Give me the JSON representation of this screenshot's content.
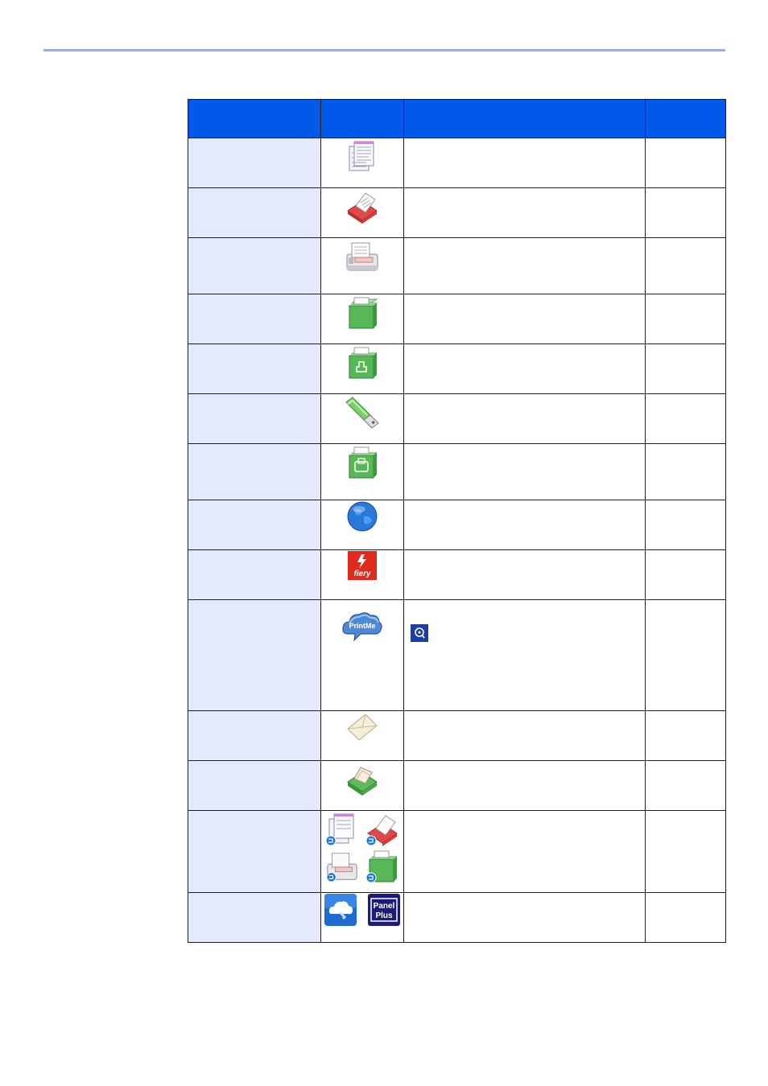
{
  "table": {
    "header": [
      "",
      "",
      "",
      ""
    ],
    "rows": [
      {
        "icons": [
          "copy-icon"
        ]
      },
      {
        "icons": [
          "send-icon"
        ]
      },
      {
        "icons": [
          "fax-icon"
        ]
      },
      {
        "icons": [
          "custom-box-icon"
        ]
      },
      {
        "icons": [
          "job-box-icon"
        ]
      },
      {
        "icons": [
          "usb-drive-icon"
        ]
      },
      {
        "icons": [
          "fax-box-icon"
        ]
      },
      {
        "icons": [
          "internet-browser-icon"
        ]
      },
      {
        "icons": [
          "fiery-icon"
        ]
      },
      {
        "icons": [
          "printme-icon"
        ],
        "note_icon": "note-icon"
      },
      {
        "icons": [
          "envelope-icon"
        ]
      },
      {
        "icons": [
          "document-box-icon"
        ]
      },
      {
        "icons": [
          "program-copy-icon",
          "program-send-icon",
          "program-fax-icon",
          "program-box-icon"
        ]
      },
      {
        "icons": [
          "cloud-app-icon"
        ],
        "logo_text": [
          "Panel",
          "Plus"
        ]
      }
    ]
  },
  "colors": {
    "header_bg": "#0059e8",
    "first_column_bg": "#e4eafb",
    "top_rule": "#8fb0e8"
  }
}
